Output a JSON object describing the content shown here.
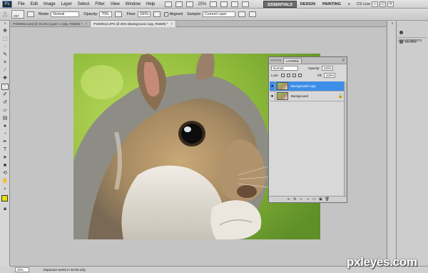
{
  "app": {
    "logo_text": "Ps"
  },
  "menubar": {
    "items": [
      "File",
      "Edit",
      "Image",
      "Layer",
      "Select",
      "Filter",
      "View",
      "Window",
      "Help"
    ],
    "zoom_label": "25%",
    "workspaces": [
      "ESSENTIALS",
      "DESIGN",
      "PAINTING"
    ],
    "workspace_more": "»",
    "cslive": "CS Live",
    "window_controls": [
      "–",
      "□",
      "×"
    ]
  },
  "options": {
    "brush_size": "257",
    "mode_label": "Mode:",
    "mode_value": "Normal",
    "opacity_label": "Opacity:",
    "opacity_value": "70%",
    "flow_label": "Flow:",
    "flow_value": "100%",
    "aligned_check": "✓",
    "aligned_label": "Aligned",
    "sample_label": "Sample:",
    "sample_value": "Current Layer"
  },
  "tabs": [
    {
      "label": "P1000613.psd @ 33.3% (Layer 1 copy, RGB/8) *",
      "close": "×"
    },
    {
      "label": "P1000613.JPG @ 25% (Background copy, RGB/8) *",
      "close": "×"
    }
  ],
  "dock": {
    "adjustments": "ADJUSTMENTS",
    "masks": "MASKS",
    "collapse": "»"
  },
  "layers_panel": {
    "tabs": [
      "PATHS",
      "LAYERS"
    ],
    "menu": "≡",
    "blend_mode": "Normal",
    "opacity_label": "Opacity:",
    "opacity_value": "100%",
    "lock_label": "Lock:",
    "fill_label": "Fill:",
    "fill_value": "100%",
    "layers": [
      {
        "name": "Background copy",
        "visible": "●",
        "lock": ""
      },
      {
        "name": "Background",
        "visible": "●",
        "lock": "🔒"
      }
    ],
    "footer_buttons": [
      "∞",
      "fx",
      "◐",
      "◑",
      "▭",
      "▣",
      "🗑"
    ]
  },
  "status": {
    "zoom": "25%",
    "message": "Exposure works in 32-bit only"
  },
  "watermark": "pxleyes.com",
  "colors": {
    "selected_layer": "#3d8ee8",
    "foreground": "#e8e000",
    "background": "#ffffff"
  }
}
